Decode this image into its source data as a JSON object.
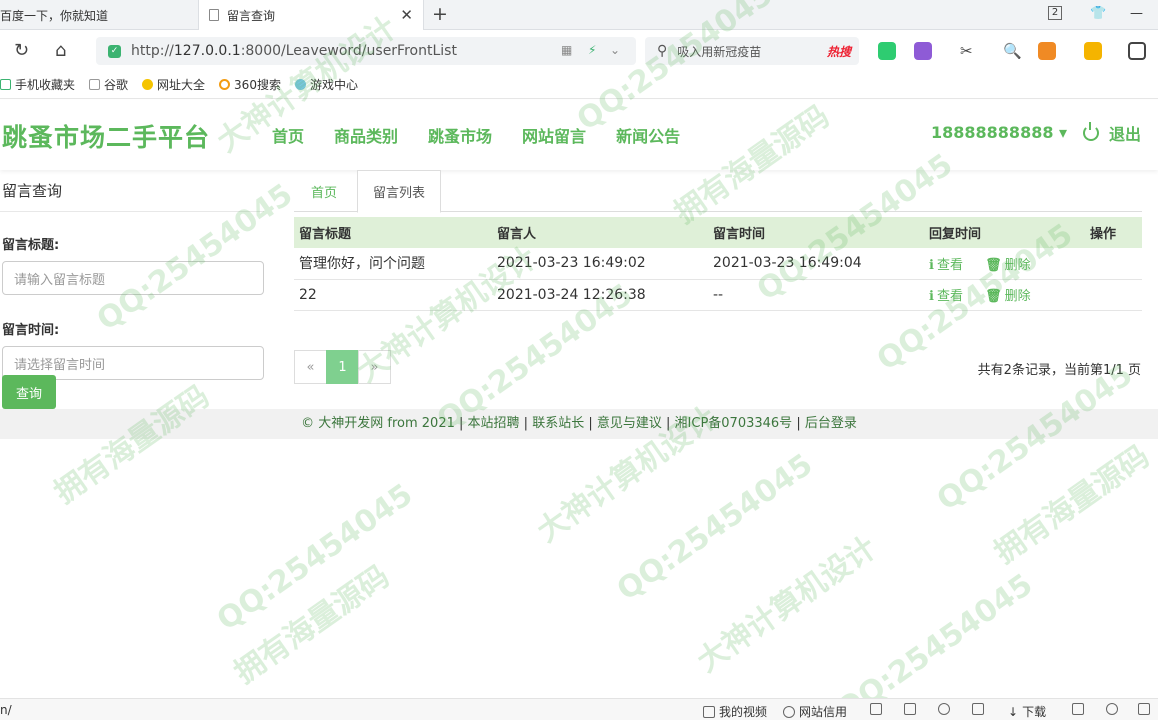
{
  "browser": {
    "tabs": [
      {
        "title": "百度一下，你就知道"
      },
      {
        "title": "留言查询"
      }
    ],
    "window_badge": "2",
    "url_prefix": "http://",
    "url_host": "127.0.0.1",
    "url_rest": ":8000/Leaveword/userFrontList",
    "search_hint": "吸入用新冠疫苗",
    "search_hot": "热搜",
    "bookmarks": [
      "手机收藏夹",
      "谷歌",
      "网址大全",
      "360搜索",
      "游戏中心"
    ]
  },
  "site": {
    "logo": "跳蚤市场二手平台",
    "nav": [
      "首页",
      "商品类别",
      "跳蚤市场",
      "网站留言",
      "新闻公告"
    ],
    "user": "18888888888 ▾",
    "logout": "退出"
  },
  "search_panel": {
    "title": "留言查询",
    "title_label": "留言标题:",
    "title_placeholder": "请输入留言标题",
    "time_label": "留言时间:",
    "time_placeholder": "请选择留言时间",
    "query_button": "查询"
  },
  "content": {
    "tabs": [
      "首页",
      "留言列表"
    ],
    "columns": [
      "留言标题",
      "留言人",
      "留言时间",
      "回复时间",
      "操作"
    ],
    "rows": [
      {
        "title": "管理你好，问个问题",
        "author": "2021-03-23 16:49:02",
        "time": "2021-03-23 16:49:04",
        "view": "查看",
        "del": "删除"
      },
      {
        "title": "22",
        "author": "2021-03-24 12:26:38",
        "time": "--",
        "view": "查看",
        "del": "删除"
      }
    ],
    "pager": {
      "prev": "«",
      "current": "1",
      "next": "»"
    },
    "page_info": "共有2条记录，当前第1/1 页"
  },
  "footer": {
    "copyright": "© 大神开发网 from 2021",
    "links": [
      "本站招聘",
      "联系站长",
      "意见与建议",
      "湘ICP备0703346号",
      "后台登录"
    ]
  },
  "statusbar": {
    "left": "n/",
    "video": "我的视频",
    "trust": "网站信用",
    "download": "下载"
  },
  "watermark": {
    "texts": [
      "QQ:25454045",
      "拥有海量源码",
      "大神计算机设计"
    ]
  },
  "colors": {
    "accent": "#5cb85c",
    "table_header": "#dff0d8",
    "pager_active": "#7fd08f"
  }
}
